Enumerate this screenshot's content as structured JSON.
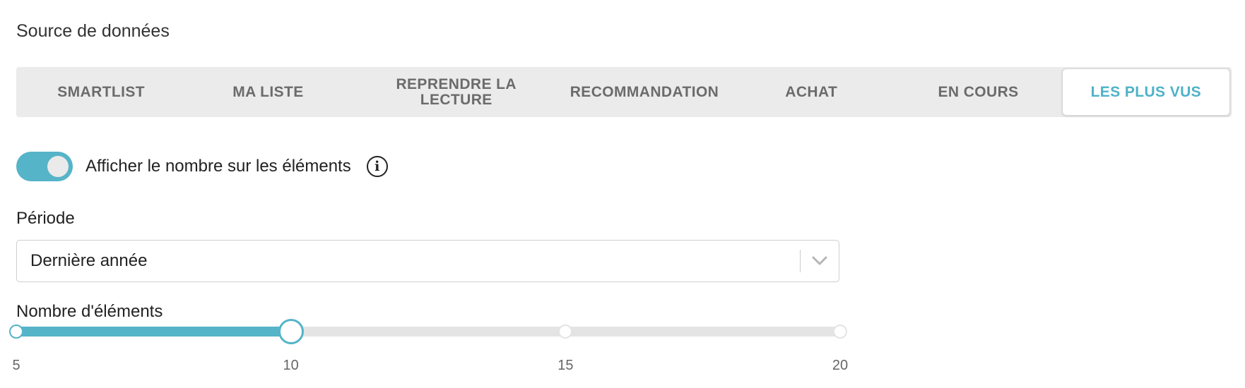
{
  "section_title": "Source de données",
  "tabs": [
    {
      "label": "SMARTLIST",
      "active": false
    },
    {
      "label": "MA LISTE",
      "active": false
    },
    {
      "label": "REPRENDRE LA LECTURE",
      "active": false
    },
    {
      "label": "RECOMMANDATION",
      "active": false
    },
    {
      "label": "ACHAT",
      "active": false
    },
    {
      "label": "EN COURS",
      "active": false
    },
    {
      "label": "LES PLUS VUS",
      "active": true
    }
  ],
  "toggle": {
    "label": "Afficher le nombre sur les éléments",
    "on": true,
    "info_icon": "info-icon"
  },
  "period": {
    "label": "Période",
    "value": "Dernière année",
    "icon": "chevron-down-icon"
  },
  "count": {
    "label": "Nombre d'éléments",
    "min": 5,
    "max": 20,
    "value": 10,
    "marks": [
      "5",
      "10",
      "15",
      "20"
    ]
  },
  "colors": {
    "accent": "#55b4c8",
    "active_tab_text": "#4fb2c7",
    "tab_bg": "#ebebeb"
  }
}
